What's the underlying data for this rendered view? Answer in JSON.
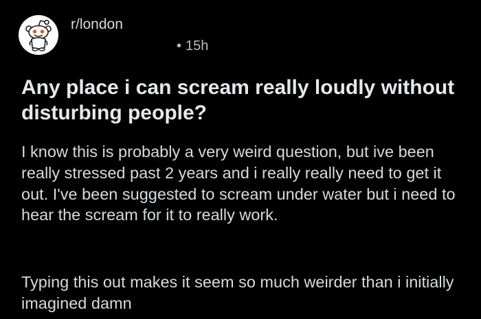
{
  "post": {
    "subreddit": "r/london",
    "avatar_icon": "reddit-snoo-icon",
    "timestamp_dot": "•",
    "timestamp": "15h",
    "title": "Any place i can scream really loudly without disturbing people?",
    "body": [
      "I know this is probably a very weird question, but ive been really stressed past 2 years and i really really need to get it out. I've been suggested to scream under water but i need to hear the scream for it to really work.",
      "Typing this out makes it seem so much weirder than i initially imagined damn"
    ]
  },
  "colors": {
    "background": "#000000",
    "text": "#d7dadc",
    "title": "#e6e8ea",
    "meta": "#b8bcbf",
    "snoo_orange": "#ff4500"
  }
}
